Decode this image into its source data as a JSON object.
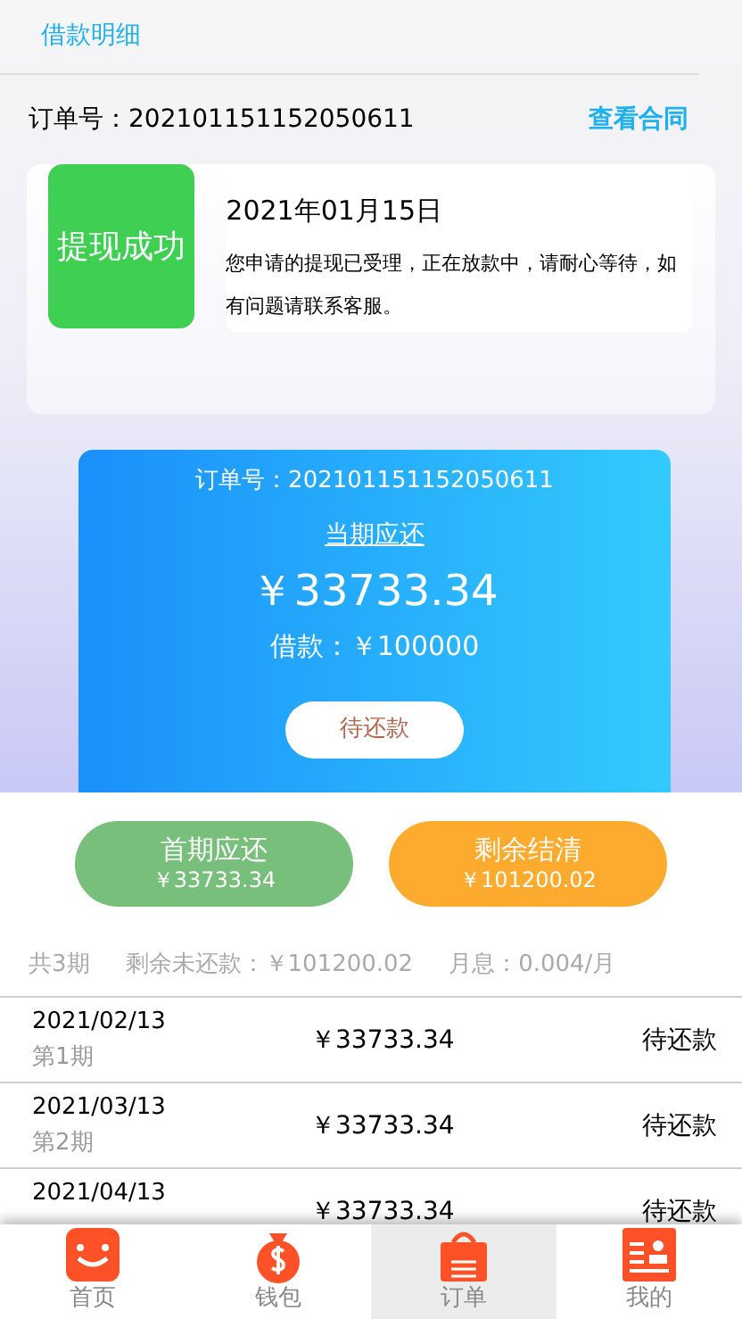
{
  "header": {
    "title": "借款明细"
  },
  "order": {
    "label": "订单号：202101151152050611",
    "contract_link": "查看合同"
  },
  "status_card": {
    "badge": "提现成功",
    "date": "2021年01月15日",
    "message": "您申请的提现已受理，正在放款中，请耐心等待，如有问题请联系客服。"
  },
  "current_card": {
    "order": "订单号：202101151152050611",
    "label": "当期应还",
    "amount": "￥33733.34",
    "loan": "借款：￥100000",
    "status_button": "待还款"
  },
  "actions": [
    {
      "kind": "first",
      "title": "首期应还",
      "amount": "￥33733.34"
    },
    {
      "kind": "settle",
      "title": "剩余结清",
      "amount": "￥101200.02"
    }
  ],
  "summary": {
    "periods": "共3期",
    "remaining": "剩余未还款：￥101200.02",
    "interest": "月息：0.004/月"
  },
  "installments": [
    {
      "date": "2021/02/13",
      "period": "第1期",
      "amount": "￥33733.34",
      "status": "待还款"
    },
    {
      "date": "2021/03/13",
      "period": "第2期",
      "amount": "￥33733.34",
      "status": "待还款"
    },
    {
      "date": "2021/04/13",
      "amount": "￥33733.34",
      "status": "待还款"
    }
  ],
  "nav": [
    {
      "kind": "home",
      "label": "首页",
      "selected": false
    },
    {
      "kind": "wallet",
      "label": "钱包",
      "selected": false
    },
    {
      "kind": "orders",
      "label": "订单",
      "selected": true
    },
    {
      "kind": "profile",
      "label": "我的",
      "selected": false
    }
  ]
}
